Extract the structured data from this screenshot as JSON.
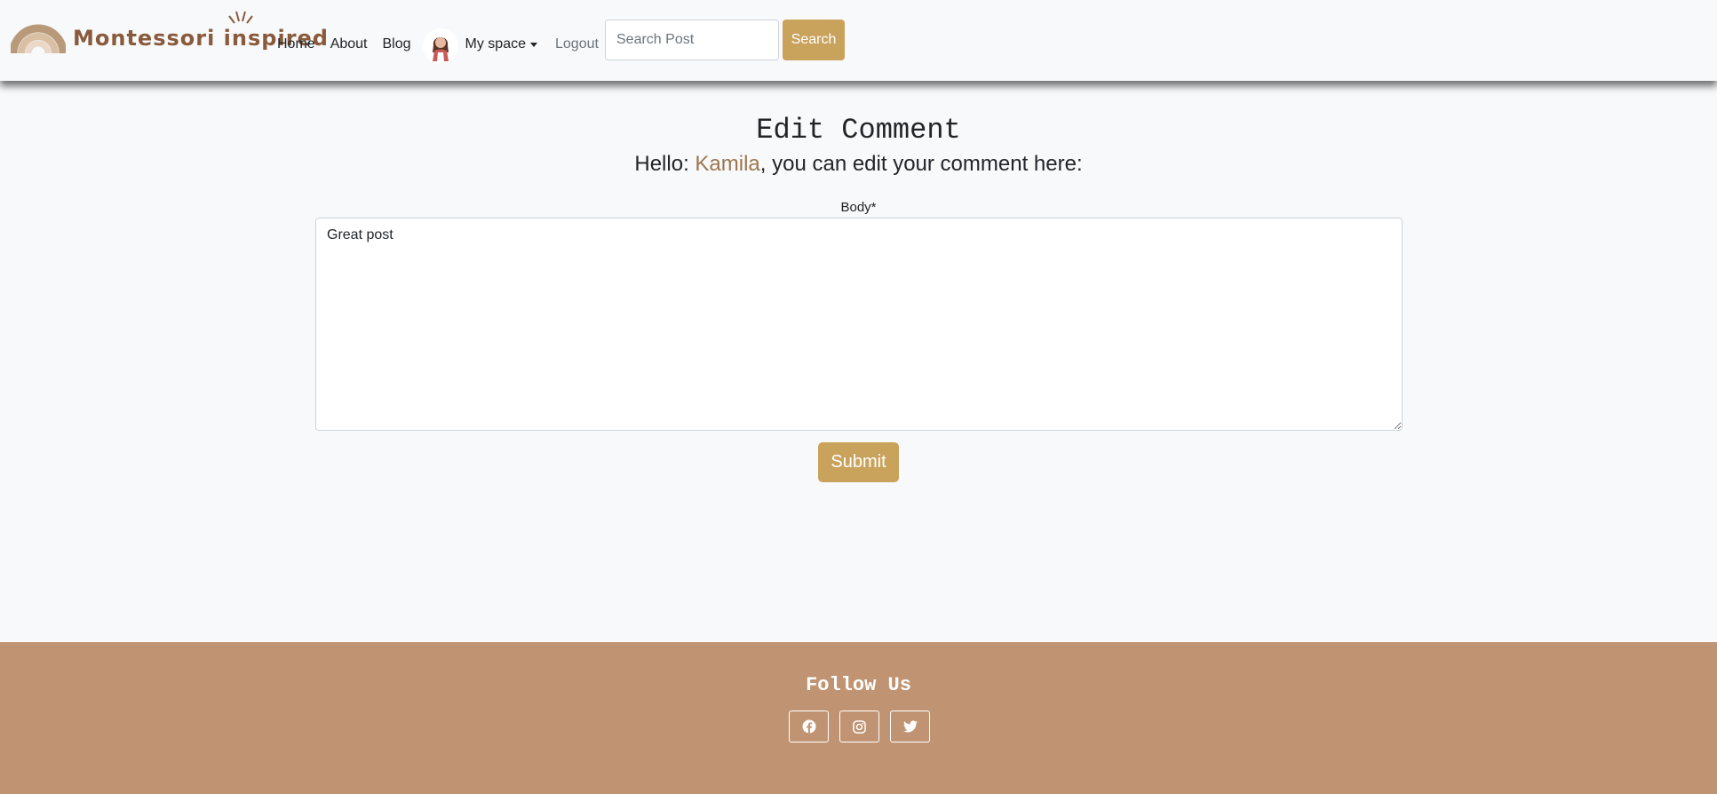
{
  "navbar": {
    "brand": "Montessori inspired",
    "links": {
      "home": "Home",
      "about": "About",
      "blog": "Blog"
    },
    "dropdown_label": "My space",
    "logout_label": "Logout",
    "search_placeholder": "Search Post",
    "search_button": "Search"
  },
  "main": {
    "title": "Edit Comment",
    "greeting_prefix": "Hello: ",
    "username": "Kamila",
    "greeting_suffix": ", you can edit your comment here:",
    "body_label": "Body*",
    "body_value": "Great post",
    "submit_label": "Submit"
  },
  "footer": {
    "follow_title": "Follow Us",
    "social_icons": [
      "facebook-icon",
      "instagram-icon",
      "twitter-icon"
    ]
  },
  "colors": {
    "accent": "#c9a35c",
    "footer_bg": "#c09472",
    "username": "#9c7650",
    "brand_text": "#8a5a3c"
  }
}
